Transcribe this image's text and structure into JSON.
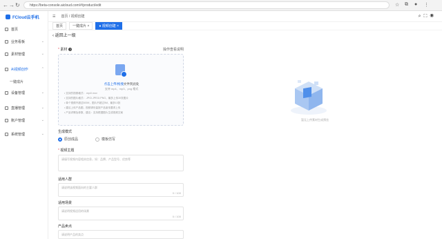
{
  "browser": {
    "url": "https://beta-console.aicloud.com/#/product/edit"
  },
  "app": {
    "logo_text": "FCloud云手机"
  },
  "sidebar": {
    "items": [
      {
        "label": "首页"
      },
      {
        "label": "业务看板"
      },
      {
        "label": "素材管理"
      },
      {
        "label": "AI视频创作"
      },
      {
        "label": "一键成片"
      },
      {
        "label": "设备管理"
      },
      {
        "label": "直播管理"
      },
      {
        "label": "账户管理"
      },
      {
        "label": "系统管理"
      }
    ]
  },
  "topbar": {
    "breadcrumb_home": "首页",
    "breadcrumb_sep": "/",
    "breadcrumb_current": "视频创建"
  },
  "tabs": [
    {
      "label": "首页"
    },
    {
      "label": "一键成片 ×"
    },
    {
      "label": "● 视频创建 ×"
    }
  ],
  "form": {
    "back": "‹ 返回上一级",
    "material_label": "素材",
    "material_link": "操作查看说明",
    "upload_title_link": "点击上传/拖拽",
    "upload_title_rest": "文件到此处",
    "upload_sub": "支持 mp4、mp3、png 格式",
    "hints": [
      "• 支持的视频格式：.mp4/.mov",
      "• 支持的图片格式：.JPG/.JPEG/.PNG，最多上传30张图片",
      "• 单个视频不超过500M，图片不超过5M，最多10张",
      "• 建议上传产品图，视频请尽量按产品宣传要求上传",
      "• 产品详情及参数，建议：支持根据图片生成视频文案"
    ],
    "mode_label": "生成模式",
    "mode_options": [
      "原创成品",
      "模板仿写"
    ],
    "title_label": "视频主题",
    "title_placeholder": "请填写视频内容相关信息，如：品牌、产品型号、优势等",
    "people_label": "适用人群",
    "people_placeholder": "请说明该视频面向的主要人群",
    "people_count": "0 / 100",
    "scene_label": "适用场景",
    "scene_placeholder": "请说明视频适用的场景",
    "scene_count": "0 / 100",
    "selling_label": "产品卖点",
    "selling_placeholder": "请说明产品的卖点"
  },
  "preview": {
    "empty_text": "暂无上传素材生成预览"
  }
}
